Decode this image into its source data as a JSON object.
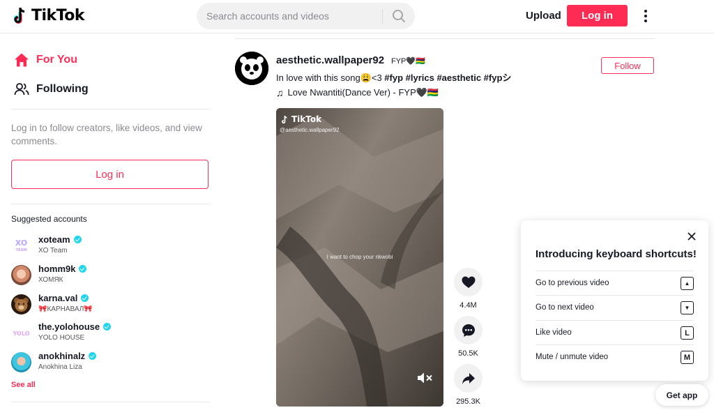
{
  "header": {
    "logo_text": "TikTok",
    "search_placeholder": "Search accounts and videos",
    "upload_label": "Upload",
    "login_label": "Log in"
  },
  "sidebar": {
    "nav": [
      {
        "label": "For You",
        "icon": "home-icon",
        "active": true
      },
      {
        "label": "Following",
        "icon": "users-icon",
        "active": false
      }
    ],
    "login_hint": "Log in to follow creators, like videos, and view comments.",
    "login_button": "Log in",
    "suggested_title": "Suggested accounts",
    "accounts": [
      {
        "username": "xoteam",
        "display_name": "XO Team",
        "verified": true
      },
      {
        "username": "homm9k",
        "display_name": "ХОМЯК",
        "verified": true
      },
      {
        "username": "karna.val",
        "display_name": "🎀КАРНАВАЛ🎀",
        "verified": true
      },
      {
        "username": "the.yolohouse",
        "display_name": "YOLO HOUSE",
        "verified": true
      },
      {
        "username": "anokhinalz",
        "display_name": "Anokhina Liza",
        "verified": true
      }
    ],
    "see_all": "See all"
  },
  "post": {
    "author_username": "aesthetic.wallpaper92",
    "author_nickname": "FYP🖤🇲🇺",
    "caption_text": "In love with this song😩<3 ",
    "hashtags": "#fyp #lyrics #aesthetic #fypシ",
    "music": "Love Nwantiti(Dance Ver) - FYP🖤🇲🇺",
    "follow_label": "Follow",
    "video": {
      "watermark_logo": "TikTok",
      "watermark_user": "@aesthetic.wallpaper92",
      "subtitle": "I want to chop your nkwobi"
    },
    "actions": [
      {
        "name": "like",
        "icon": "heart-icon",
        "count": "4.4M"
      },
      {
        "name": "comment",
        "icon": "comment-icon",
        "count": "50.5K"
      },
      {
        "name": "share",
        "icon": "share-icon",
        "count": "295.3K"
      }
    ]
  },
  "shortcuts": {
    "title": "Introducing keyboard shortcuts!",
    "items": [
      {
        "label": "Go to previous video",
        "key": "▲"
      },
      {
        "label": "Go to next video",
        "key": "▼"
      },
      {
        "label": "Like video",
        "key": "L"
      },
      {
        "label": "Mute / unmute video",
        "key": "M"
      }
    ]
  },
  "get_app": "Get app",
  "colors": {
    "brand": "#fe2c55",
    "verified": "#20d5ec",
    "text": "#161823",
    "muted": "#8a8b91"
  }
}
